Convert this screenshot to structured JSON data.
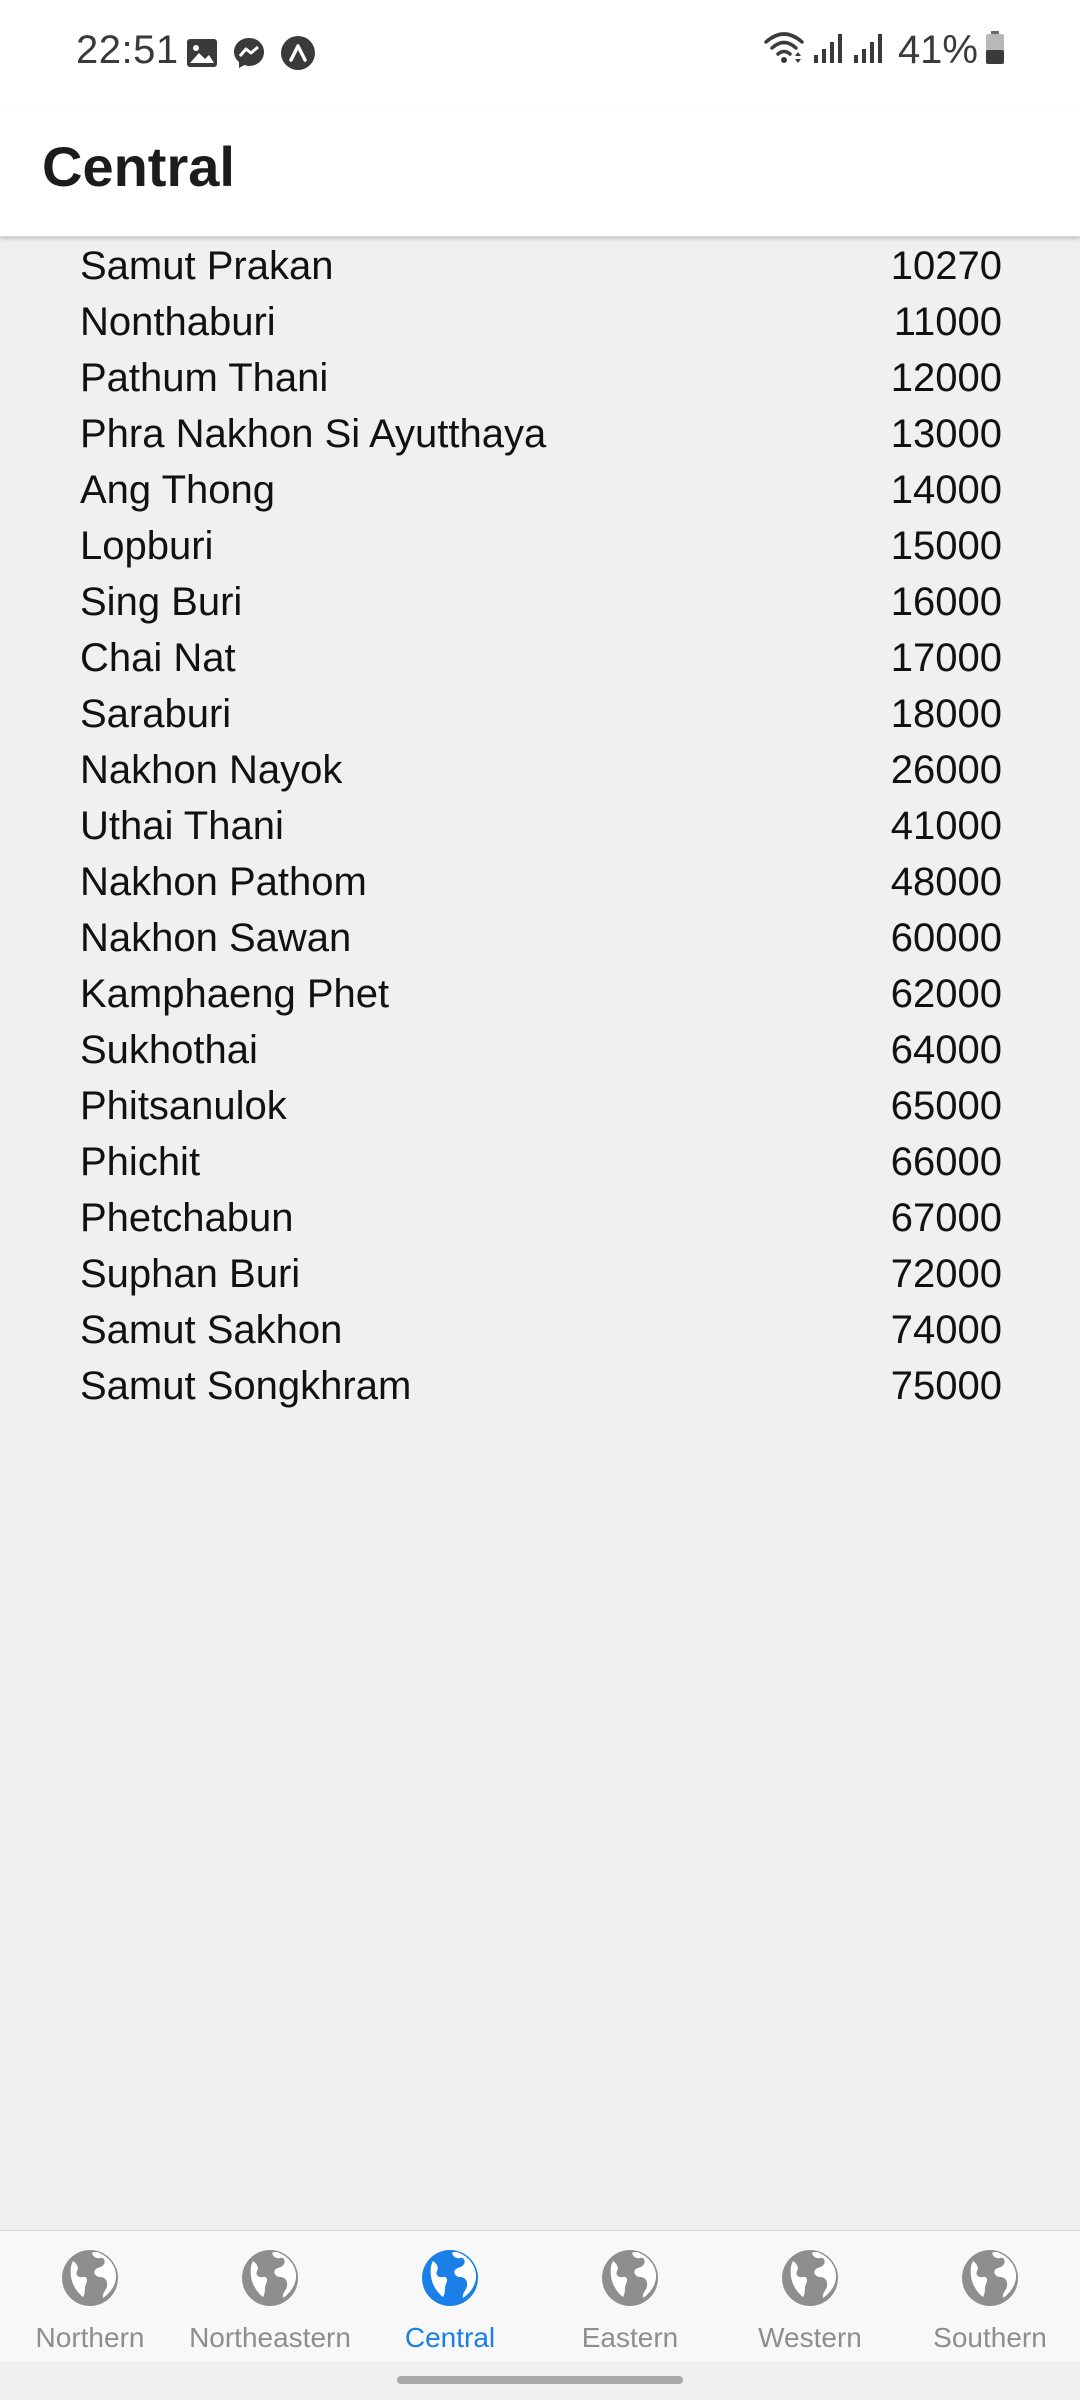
{
  "status": {
    "time": "22:51",
    "battery": "41%",
    "left_icons": [
      "gallery-icon",
      "messenger-icon",
      "app-icon"
    ],
    "right_icons": [
      "wifi-icon",
      "signal-icon",
      "signal-icon",
      "battery-icon"
    ]
  },
  "header": {
    "title": "Central"
  },
  "provinces": [
    {
      "name": "Samut Prakan",
      "code": "10270"
    },
    {
      "name": "Nonthaburi",
      "code": "11000"
    },
    {
      "name": "Pathum Thani",
      "code": "12000"
    },
    {
      "name": "Phra Nakhon Si Ayutthaya",
      "code": "13000"
    },
    {
      "name": "Ang Thong",
      "code": "14000"
    },
    {
      "name": "Lopburi",
      "code": "15000"
    },
    {
      "name": "Sing Buri",
      "code": "16000"
    },
    {
      "name": "Chai Nat",
      "code": "17000"
    },
    {
      "name": "Saraburi",
      "code": "18000"
    },
    {
      "name": "Nakhon Nayok",
      "code": "26000"
    },
    {
      "name": "Uthai Thani",
      "code": "41000"
    },
    {
      "name": "Nakhon Pathom",
      "code": "48000"
    },
    {
      "name": "Nakhon Sawan",
      "code": "60000"
    },
    {
      "name": "Kamphaeng Phet",
      "code": "62000"
    },
    {
      "name": "Sukhothai",
      "code": "64000"
    },
    {
      "name": "Phitsanulok",
      "code": "65000"
    },
    {
      "name": "Phichit",
      "code": "66000"
    },
    {
      "name": "Phetchabun",
      "code": "67000"
    },
    {
      "name": "Suphan Buri",
      "code": "72000"
    },
    {
      "name": "Samut Sakhon",
      "code": "74000"
    },
    {
      "name": "Samut Songkhram",
      "code": "75000"
    }
  ],
  "tabs": [
    {
      "label": "Northern",
      "icon": "globe-icon",
      "active": false
    },
    {
      "label": "Northeastern",
      "icon": "globe-icon",
      "active": false
    },
    {
      "label": "Central",
      "icon": "globe-icon",
      "active": true
    },
    {
      "label": "Eastern",
      "icon": "globe-icon",
      "active": false
    },
    {
      "label": "Western",
      "icon": "globe-icon",
      "active": false
    },
    {
      "label": "Southern",
      "icon": "globe-icon",
      "active": false
    }
  ],
  "colors": {
    "active": "#1a7fe6",
    "inactive": "#8e8e8e",
    "background": "#f0f0f0"
  }
}
